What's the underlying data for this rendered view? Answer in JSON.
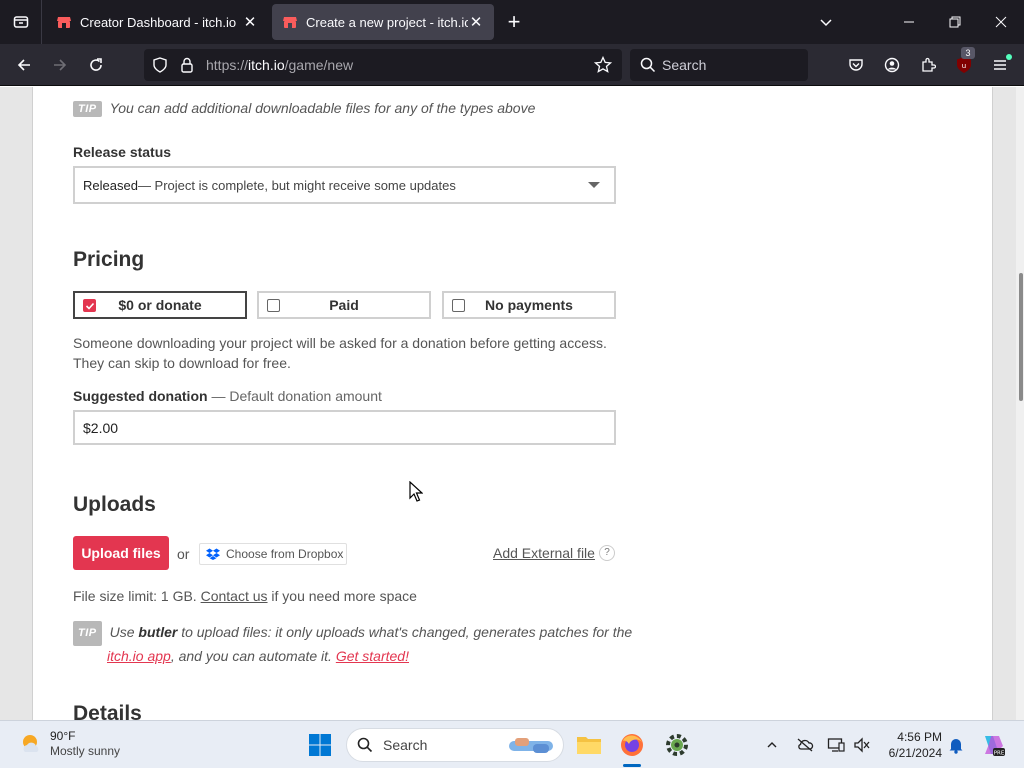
{
  "browser": {
    "tabs": [
      {
        "title": "Creator Dashboard - itch.io",
        "active": false
      },
      {
        "title": "Create a new project - itch.io",
        "active": true
      }
    ],
    "url": {
      "host_prefix": "https://",
      "host": "itch.io",
      "path": "/game/new"
    },
    "search_placeholder": "Search",
    "extension_badge_count": "3",
    "icons": [
      "tab-overview-icon",
      "new-tab-icon",
      "list-all-tabs-icon",
      "back-icon",
      "forward-icon",
      "reload-icon",
      "shield-icon",
      "lock-icon",
      "bookmark-star-icon",
      "pocket-icon",
      "account-icon",
      "extensions-icon",
      "ublock-icon",
      "menu-icon"
    ]
  },
  "page": {
    "tip_top": {
      "badge": "TIP",
      "text": "You can add additional downloadable files for any of the types above"
    },
    "release_status": {
      "label": "Release status",
      "selected_strong": "Released",
      "selected_rest": " — Project is complete, but might receive some updates"
    },
    "pricing": {
      "heading": "Pricing",
      "options": [
        {
          "label": "$0 or donate",
          "checked": true
        },
        {
          "label": "Paid",
          "checked": false
        },
        {
          "label": "No payments",
          "checked": false
        }
      ],
      "description_line1": "Someone downloading your project will be asked for a donation before getting access.",
      "description_line2": "They can skip to download for free.",
      "donation_label": "Suggested donation",
      "donation_sub": " — Default donation amount",
      "donation_value": "$2.00"
    },
    "uploads": {
      "heading": "Uploads",
      "upload_button": "Upload files",
      "or": "or",
      "dropbox_button": "Choose from Dropbox",
      "external_link": "Add External file",
      "help": "?",
      "size_limit_prefix": "File size limit: 1 GB. ",
      "contact_link": "Contact us",
      "size_limit_suffix": " if you need more space",
      "tip_badge": "TIP",
      "tip_use": "Use ",
      "tip_butler": "butler",
      "tip_mid": " to upload files: it only uploads what's changed, generates patches for the",
      "tip_app_link": "itch.io app",
      "tip_mid2": ", and you can automate it. ",
      "tip_get_started": "Get started!"
    },
    "details_heading": "Details"
  },
  "taskbar": {
    "weather_temp": "90°F",
    "weather_desc": "Mostly sunny",
    "search_placeholder": "Search",
    "time": "4:56 PM",
    "date": "6/21/2024"
  },
  "colors": {
    "accent": "#e33650",
    "tab_bg": "#1c1b22",
    "active_tab": "#42414d",
    "nav_bg": "#2b2a33"
  }
}
